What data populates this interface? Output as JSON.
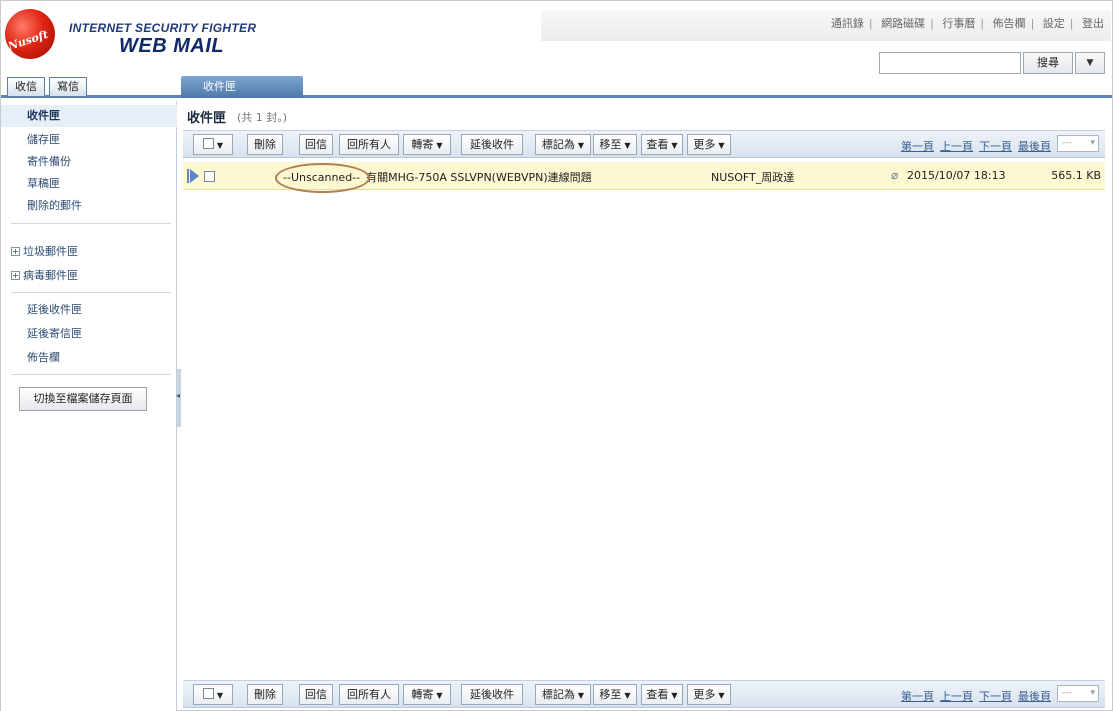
{
  "header": {
    "logo_text": "Nusoft",
    "brand_line1": "INTERNET SECURITY FIGHTER",
    "brand_line2": "WEB MAIL",
    "top_links": [
      "通訊錄",
      "網路磁碟",
      "行事曆",
      "佈告欄",
      "設定",
      "登出"
    ],
    "search": {
      "value": "",
      "placeholder": "",
      "button": "搜尋",
      "dropdown_icon": "caret-down-icon"
    }
  },
  "tabs": {
    "inbox_btn": "收信",
    "compose_btn": "寫信",
    "active_tab": "收件匣"
  },
  "sidebar": {
    "items": [
      {
        "label": "收件匣",
        "active": true
      },
      {
        "label": "儲存匣"
      },
      {
        "label": "寄件備份"
      },
      {
        "label": "草稿匣"
      },
      {
        "label": "刪除的郵件"
      }
    ],
    "expandable": [
      {
        "label": "垃圾郵件匣"
      },
      {
        "label": "病毒郵件匣"
      }
    ],
    "extra": [
      {
        "label": "延後收件匣"
      },
      {
        "label": "延後寄信匣"
      },
      {
        "label": "佈告欄"
      }
    ],
    "switch_button": "切換至檔案儲存頁面"
  },
  "main": {
    "title": "收件匣",
    "count": "(共 1 封。)",
    "toolbar": {
      "delete": "刪除",
      "reply": "回信",
      "reply_all": "回所有人",
      "forward": "轉寄",
      "delay": "延後收件",
      "mark_as": "標記為",
      "move_to": "移至",
      "view": "查看",
      "more": "更多"
    },
    "pager": {
      "first": "第一頁",
      "prev": "上一頁",
      "next": "下一頁",
      "last": "最後頁",
      "select": "---"
    },
    "messages": [
      {
        "tag": "--Unscanned--",
        "subject": "有關MHG-750A SSLVPN(WEBVPN)連線問題",
        "sender": "NUSOFT_周政達",
        "date": "2015/10/07 18:13",
        "size": "565.1 KB",
        "has_attachment": true
      }
    ]
  }
}
